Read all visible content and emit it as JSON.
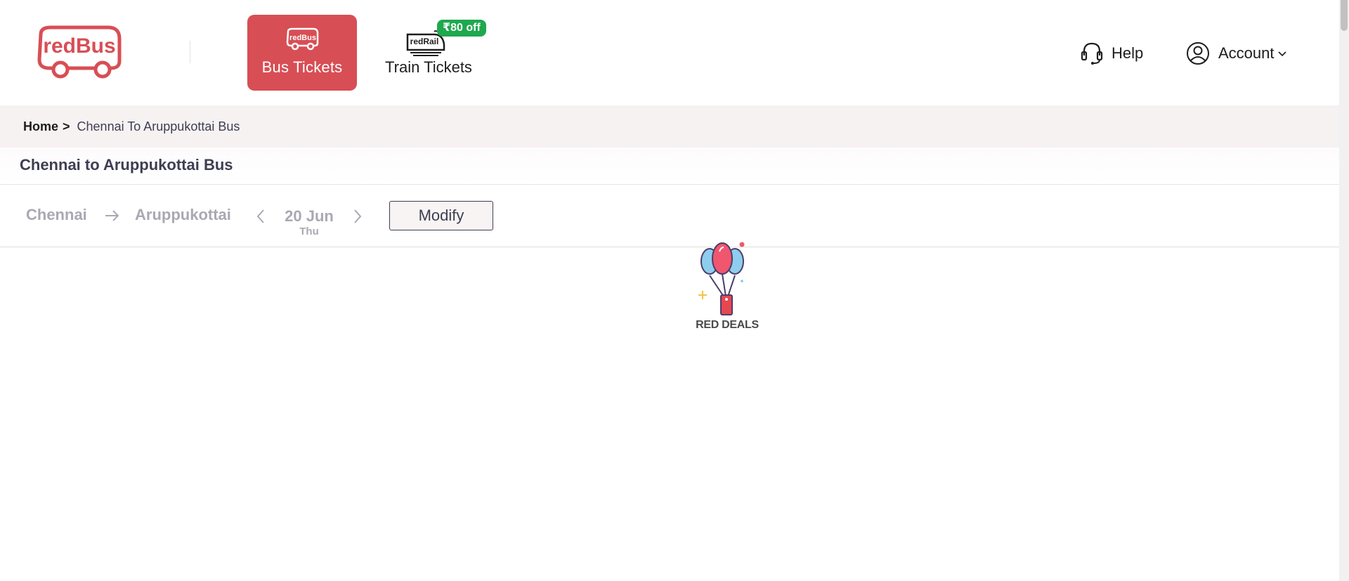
{
  "header": {
    "logo_text": "redBus",
    "tabs": [
      {
        "label": "Bus Tickets",
        "icon_text": "redBus",
        "icon": "bus-icon",
        "active": true
      },
      {
        "label": "Train Tickets",
        "icon_text": "redRail",
        "icon": "train-icon",
        "active": false
      }
    ],
    "offer_badge": "₹80 off",
    "help_label": "Help",
    "account_label": "Account"
  },
  "breadcrumb": {
    "home": "Home",
    "separator": ">",
    "current": "Chennai To Aruppukottai Bus"
  },
  "page_title": "Chennai to Aruppukottai Bus",
  "search": {
    "source": "Chennai",
    "destination": "Aruppukottai",
    "date": "20 Jun",
    "weekday": "Thu",
    "modify_label": "Modify"
  },
  "loader": {
    "label": "RED DEALS"
  },
  "colors": {
    "brand": "#d84e55",
    "offer": "#1fa84f",
    "breadcrumb_bg": "#f7f2f2",
    "muted_text": "#a9a9b3"
  }
}
